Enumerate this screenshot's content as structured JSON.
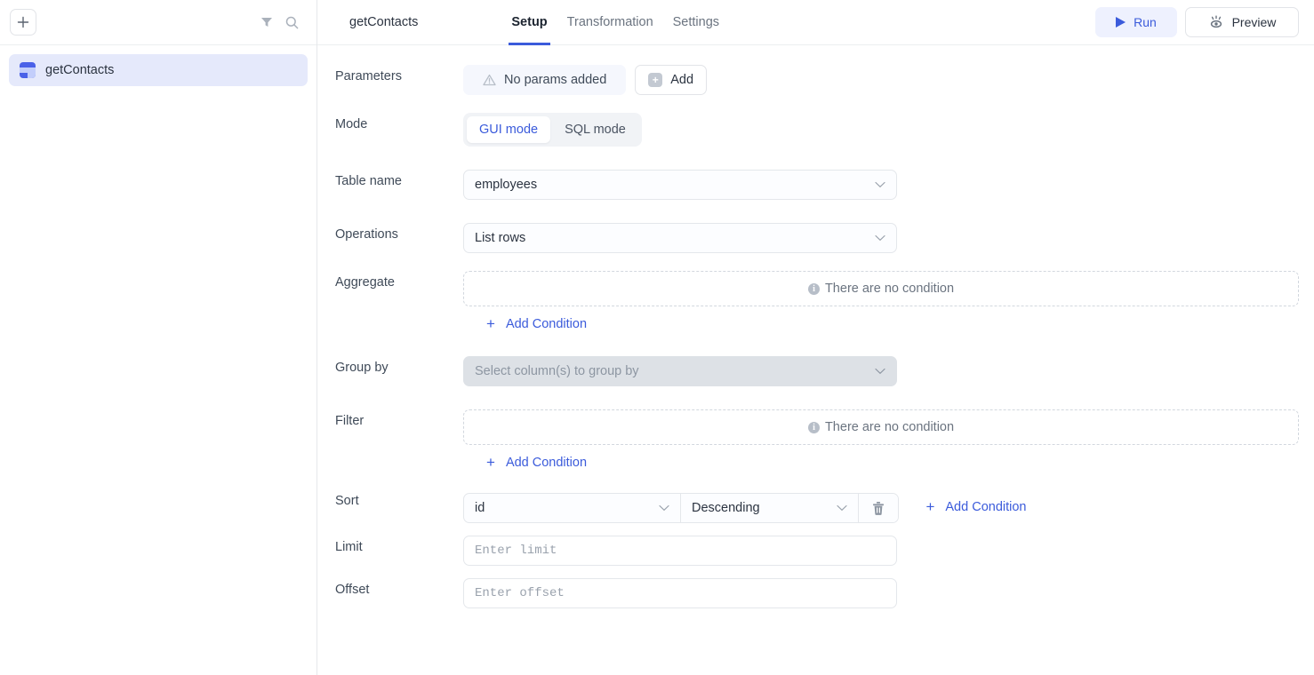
{
  "sidebar": {
    "add_button_label": "+",
    "filter_icon": "filter-icon",
    "search_icon": "search-icon",
    "items": [
      {
        "label": "getContacts",
        "icon": "database-query-icon",
        "selected": true
      }
    ]
  },
  "header": {
    "query_title": "getContacts",
    "tabs": [
      {
        "label": "Setup",
        "active": true
      },
      {
        "label": "Transformation",
        "active": false
      },
      {
        "label": "Settings",
        "active": false
      }
    ],
    "run_label": "Run",
    "preview_label": "Preview",
    "run_icon": "play-icon",
    "preview_icon": "eye-icon",
    "accent_color": "#3b5bdb"
  },
  "form": {
    "parameters": {
      "label": "Parameters",
      "empty_text": "No params added",
      "warning_icon": "warning-triangle-icon",
      "add_label": "Add",
      "add_icon": "plus-square-icon"
    },
    "mode": {
      "label": "Mode",
      "options": [
        {
          "label": "GUI mode",
          "active": true
        },
        {
          "label": "SQL mode",
          "active": false
        }
      ]
    },
    "table_name": {
      "label": "Table name",
      "value": "employees",
      "chevron_icon": "chevron-down-icon"
    },
    "operations": {
      "label": "Operations",
      "value": "List rows",
      "chevron_icon": "chevron-down-icon"
    },
    "aggregate": {
      "label": "Aggregate",
      "empty_text": "There are no condition",
      "info_icon": "info-circle-icon",
      "add_condition_label": "Add Condition",
      "add_condition_icon": "plus-icon"
    },
    "group_by": {
      "label": "Group by",
      "placeholder": "Select column(s) to group by",
      "value": "",
      "disabled": true,
      "chevron_icon": "chevron-down-icon"
    },
    "filter": {
      "label": "Filter",
      "empty_text": "There are no condition",
      "info_icon": "info-circle-icon",
      "add_condition_label": "Add Condition",
      "add_condition_icon": "plus-icon"
    },
    "sort": {
      "label": "Sort",
      "column_value": "id",
      "direction_value": "Descending",
      "delete_icon": "trash-icon",
      "chevron_icon": "chevron-down-icon",
      "add_condition_label": "Add Condition",
      "add_condition_icon": "plus-icon"
    },
    "limit": {
      "label": "Limit",
      "placeholder": "Enter limit",
      "value": ""
    },
    "offset": {
      "label": "Offset",
      "placeholder": "Enter offset",
      "value": ""
    }
  }
}
